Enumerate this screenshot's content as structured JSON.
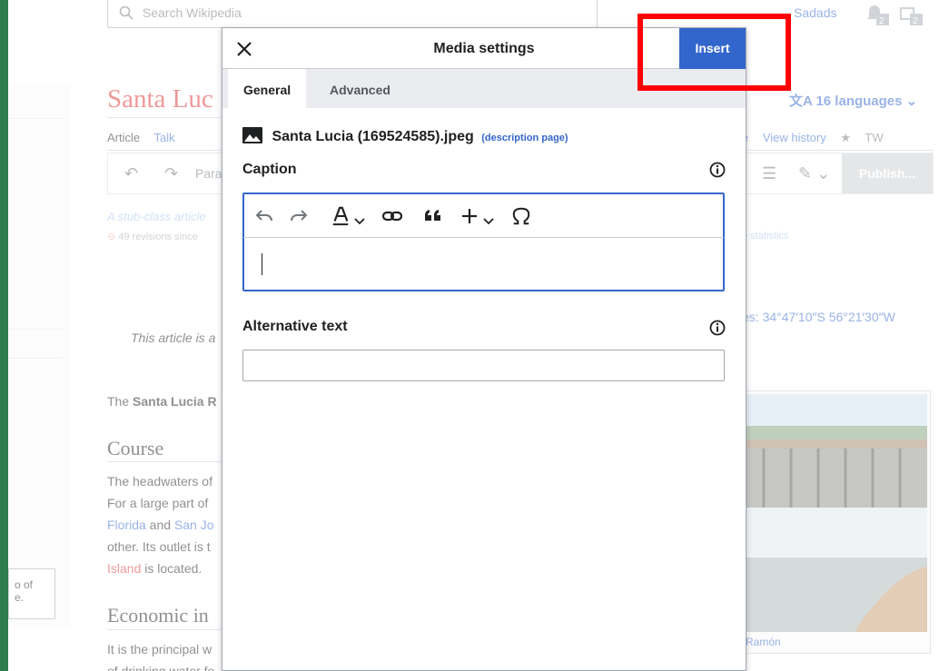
{
  "background": {
    "search_placeholder": "Search Wikipedia",
    "username": "Sadads",
    "notif_count_1": "2",
    "notif_count_2": "2",
    "page_title": "Santa Luc",
    "languages": "16 languages",
    "tab_article": "Article",
    "tab_talk": "Talk",
    "tab_view_history": "View history",
    "tab_tw": "TW",
    "tab_e": "e",
    "toolbar_para": "Para",
    "publish": "Publish...",
    "stub_text": "A stub-class article",
    "revisions": "49 revisions since",
    "statistics": "e statistics",
    "coordinates": "es: 34°47′10″S 56°21′30″W",
    "stub_notice": "This article is a",
    "intro_prefix": "The ",
    "intro_bold": "Santa Lucia R",
    "heading_course": "Course",
    "course_line1": "The headwaters of",
    "course_line2": "For a large part of",
    "course_florida": "Florida",
    "course_and": " and ",
    "course_sanjo": "San Jo",
    "course_line4": "other.  Its outlet is t",
    "course_island": "Island",
    "course_is_located": " is located.",
    "heading_economic": "Economic in",
    "econ_line1": "It is the principal w",
    "econ_line2": "of drinking water fo",
    "left_box_text_1": "o of",
    "left_box_text_2": "e.",
    "image_caption": "Ramón"
  },
  "dialog": {
    "title": "Media settings",
    "insert_label": "Insert",
    "tab_general": "General",
    "tab_advanced": "Advanced",
    "filename": "Santa Lucia (169524585).jpeg",
    "description_link": "(description page)",
    "caption_label": "Caption",
    "alt_label": "Alternative text",
    "alt_value": ""
  }
}
